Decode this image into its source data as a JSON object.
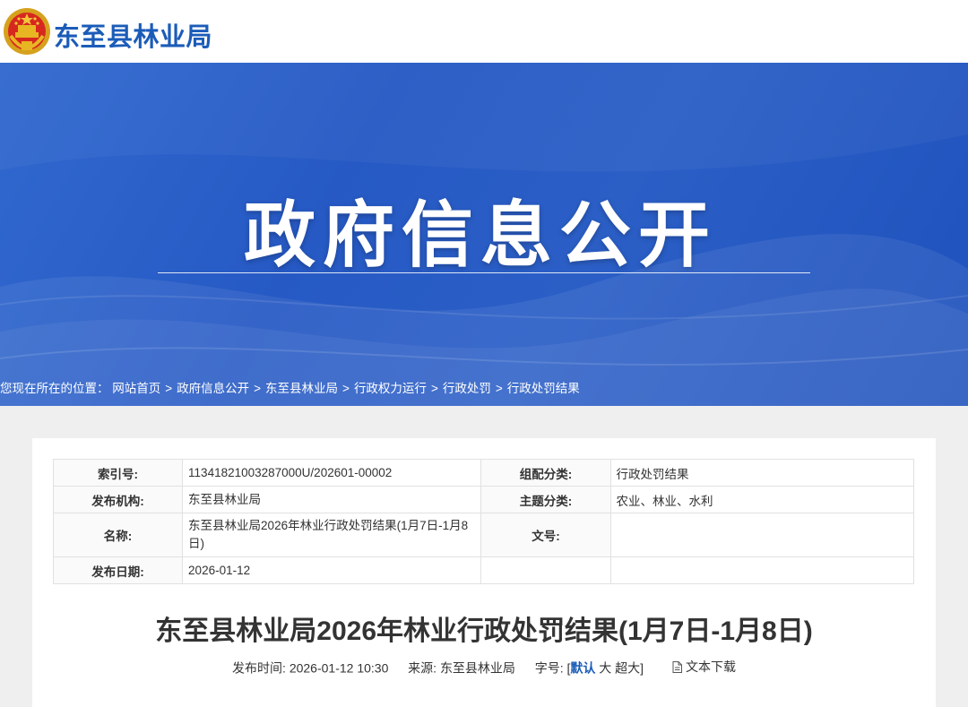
{
  "header": {
    "site_name": "东至县林业局"
  },
  "banner": {
    "title": "政府信息公开"
  },
  "breadcrumb": {
    "prefix": "您现在所在的位置：",
    "items": [
      "网站首页",
      "政府信息公开",
      "东至县林业局",
      "行政权力运行",
      "行政处罚",
      "行政处罚结果"
    ],
    "separator": ">"
  },
  "meta": {
    "index_label": "索引号:",
    "index_value": "11341821003287000U/202601-00002",
    "category_label": "组配分类:",
    "category_value": "行政处罚结果",
    "publisher_label": "发布机构:",
    "publisher_value": "东至县林业局",
    "topic_label": "主题分类:",
    "topic_value": "农业、林业、水利",
    "name_label": "名称:",
    "name_value": "东至县林业局2026年林业行政处罚结果(1月7日-1月8日)",
    "docno_label": "文号:",
    "docno_value": "",
    "date_label": "发布日期:",
    "date_value": "2026-01-12"
  },
  "article": {
    "title": "东至县林业局2026年林业行政处罚结果(1月7日-1月8日)",
    "time_label": "发布时间:",
    "time_value": "2026-01-12 10:30",
    "source_label": "来源:",
    "source_value": "东至县林业局",
    "font_label": "字号:",
    "font_open": "[",
    "font_default": "默认",
    "font_large": "大",
    "font_xlarge": "超大",
    "font_close": "]",
    "download_label": "文本下载"
  },
  "colors": {
    "brand": "#1b5cb8",
    "banner": "#2659c4"
  }
}
